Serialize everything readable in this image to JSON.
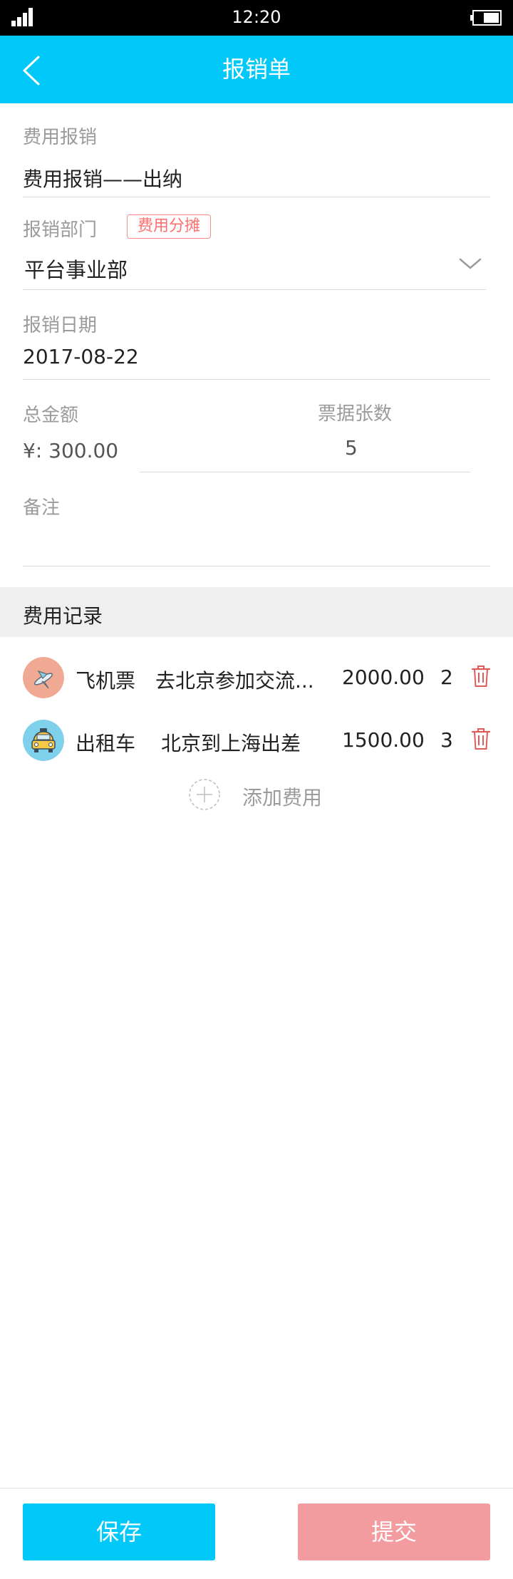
{
  "status_bar": {
    "time": "12:20"
  },
  "header": {
    "title": "报销单"
  },
  "form": {
    "expense_type": {
      "label": "费用报销",
      "value": "费用报销——出纳"
    },
    "department": {
      "label": "报销部门",
      "tag": "费用分摊",
      "value": "平台事业部"
    },
    "date": {
      "label": "报销日期",
      "value": "2017-08-22"
    },
    "total": {
      "label": "总金额",
      "value": "¥: 300.00"
    },
    "receipts": {
      "label": "票据张数",
      "value": "5"
    },
    "note": {
      "label": "备注",
      "value": ""
    }
  },
  "records": {
    "title": "费用记录",
    "items": [
      {
        "category": "飞机票",
        "description": "去北京参加交流...",
        "amount": "2000.00",
        "count": "2",
        "icon": "airplane-icon"
      },
      {
        "category": "出租车",
        "description": "北京到上海出差",
        "amount": "1500.00",
        "count": "3",
        "icon": "taxi-icon"
      }
    ],
    "add_label": "添加费用"
  },
  "footer": {
    "save_label": "保存",
    "submit_label": "提交"
  },
  "colors": {
    "primary": "#00c8f8",
    "submit": "#f39ca0",
    "tag": "#ff6f6f",
    "delete": "#e05a5a",
    "airplane_bg": "#f0a992",
    "taxi_bg": "#7fd0ea"
  }
}
